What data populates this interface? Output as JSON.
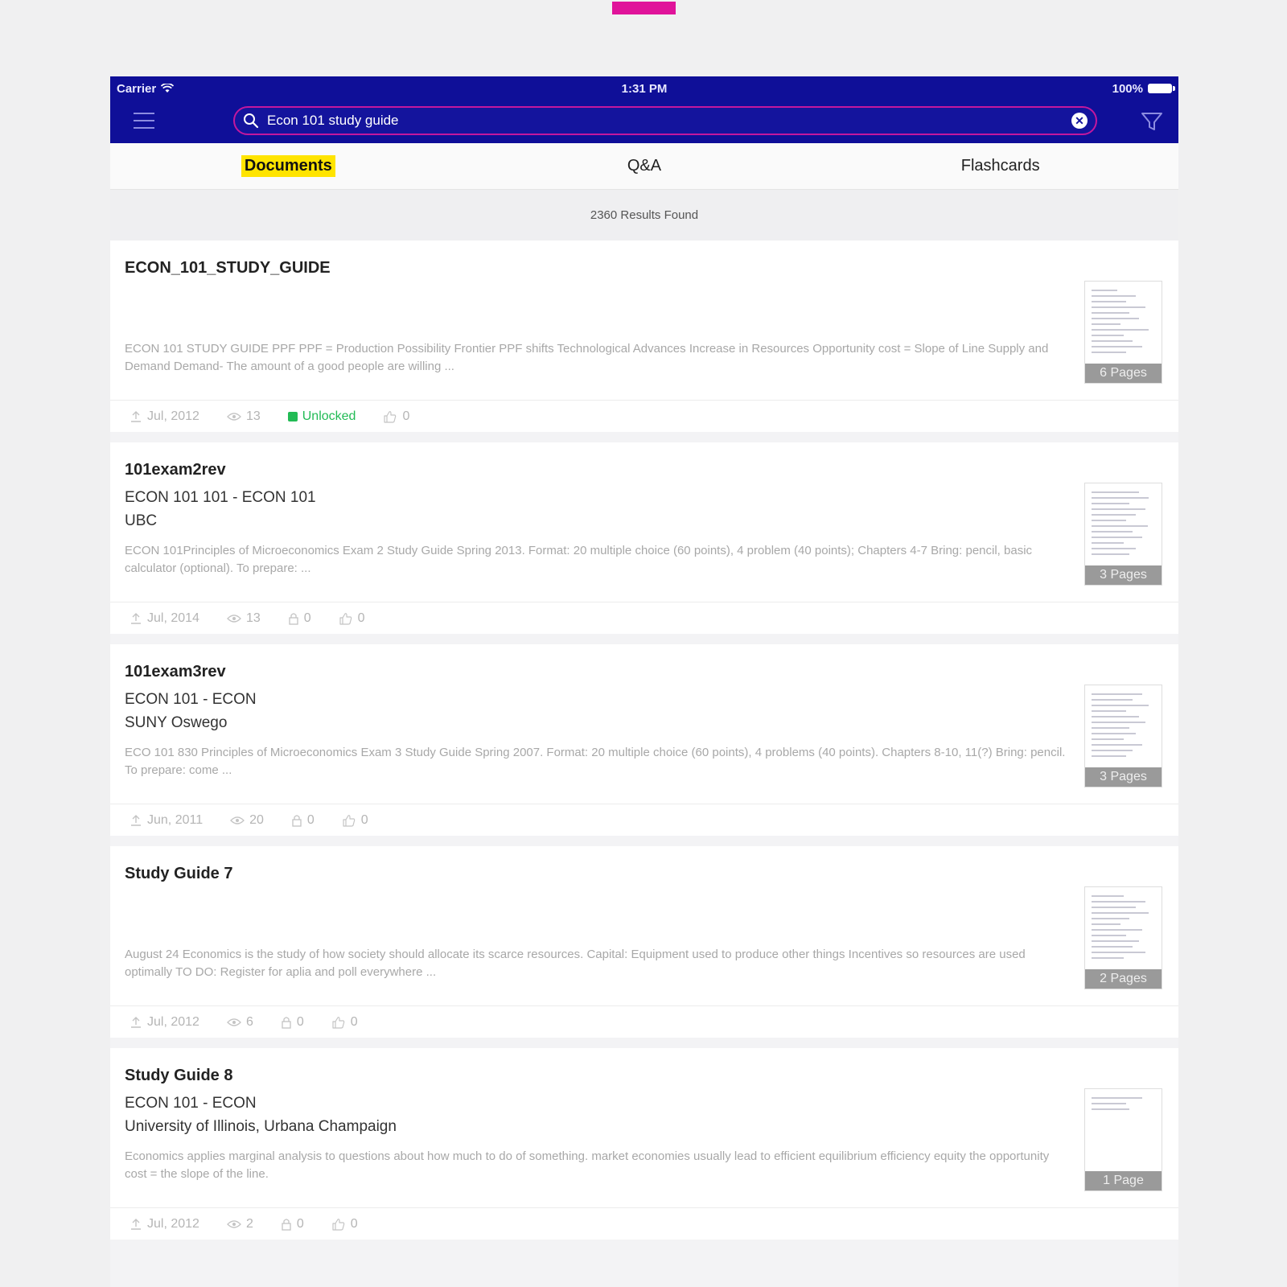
{
  "status_bar": {
    "carrier": "Carrier",
    "time": "1:31 PM",
    "battery": "100%"
  },
  "search": {
    "value": "Econ 101 study guide"
  },
  "tabs": [
    {
      "label": "Documents",
      "active": true
    },
    {
      "label": "Q&A",
      "active": false
    },
    {
      "label": "Flashcards",
      "active": false
    }
  ],
  "results": {
    "text": "2360 Results Found"
  },
  "documents": [
    {
      "title": "ECON_101_STUDY_GUIDE",
      "course": "",
      "school": "",
      "snippet": "ECON 101 STUDY GUIDE PPF PPF = Production Possibility Frontier PPF shifts Technological Advances Increase in Resources Opportunity cost = Slope of Line Supply and Demand Demand- The amount of a good people are willing ...",
      "pages": "6 Pages",
      "date": "Jul, 2012",
      "views": "13",
      "unlocked": "Unlocked",
      "likes": "0"
    },
    {
      "title": "101exam2rev",
      "course": "ECON 101 101 - ECON 101",
      "school": "UBC",
      "snippet": "ECON 101Principles of Microeconomics Exam 2 Study Guide Spring 2013. Format: 20 multiple choice (60 points), 4 problem (40 points); Chapters 4-7 Bring: pencil, basic calculator (optional). To prepare: ...",
      "pages": "3 Pages",
      "date": "Jul, 2014",
      "views": "13",
      "unlocks": "0",
      "likes": "0"
    },
    {
      "title": "101exam3rev",
      "course": "ECON 101 - ECON",
      "school": "SUNY Oswego",
      "snippet": "ECO 101 830 Principles of Microeconomics Exam 3 Study Guide Spring 2007. Format: 20 multiple choice (60 points), 4 problems (40 points). Chapters 8-10, 11(?) Bring: pencil. To prepare: come ...",
      "pages": "3 Pages",
      "date": "Jun, 2011",
      "views": "20",
      "unlocks": "0",
      "likes": "0"
    },
    {
      "title": "Study Guide 7",
      "course": "",
      "school": "",
      "snippet": "August 24 Economics is the study of how society should allocate its scarce resources. Capital: Equipment used to produce other things Incentives so resources are used optimally TO DO: Register for aplia and poll everywhere ...",
      "pages": "2 Pages",
      "date": "Jul, 2012",
      "views": "6",
      "unlocks": "0",
      "likes": "0"
    },
    {
      "title": "Study Guide 8",
      "course": "ECON 101 - ECON",
      "school": "University of Illinois, Urbana Champaign",
      "snippet": "Economics applies marginal analysis to questions about how much to do of something. market economies usually lead to efficient equilibrium efficiency equity the opportunity cost = the slope of the line.",
      "pages": "1 Page",
      "date": "Jul, 2012",
      "views": "2",
      "unlocks": "0",
      "likes": "0"
    }
  ],
  "colors": {
    "header": "#0f0f98",
    "accent": "#e0139a",
    "active_tab": "#ffe400",
    "unlocked": "#22bb55"
  }
}
